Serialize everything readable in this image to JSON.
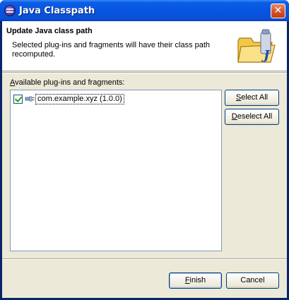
{
  "window": {
    "title": "Java Classpath"
  },
  "header": {
    "title": "Update Java class path",
    "message": "Selected plug-ins and fragments will have their class path recomputed."
  },
  "list": {
    "label_prefix": "",
    "label_mnemonic": "A",
    "label_rest": "vailable plug-ins and fragments:",
    "items": [
      {
        "label": "com.example.xyz (1.0.0)",
        "checked": true
      }
    ]
  },
  "buttons": {
    "select_all_mnemonic": "S",
    "select_all_rest": "elect All",
    "deselect_all_mnemonic": "D",
    "deselect_all_rest": "eselect All",
    "finish_mnemonic": "F",
    "finish_rest": "inish",
    "cancel": "Cancel"
  },
  "icons": {
    "title": "eclipse-icon",
    "close": "close-icon",
    "header": "folder-jar-icon",
    "item": "plugin-icon"
  },
  "colors": {
    "titlebar": "#0656e0",
    "dialog_bg": "#ece9d8",
    "close_button": "#d4522a"
  }
}
